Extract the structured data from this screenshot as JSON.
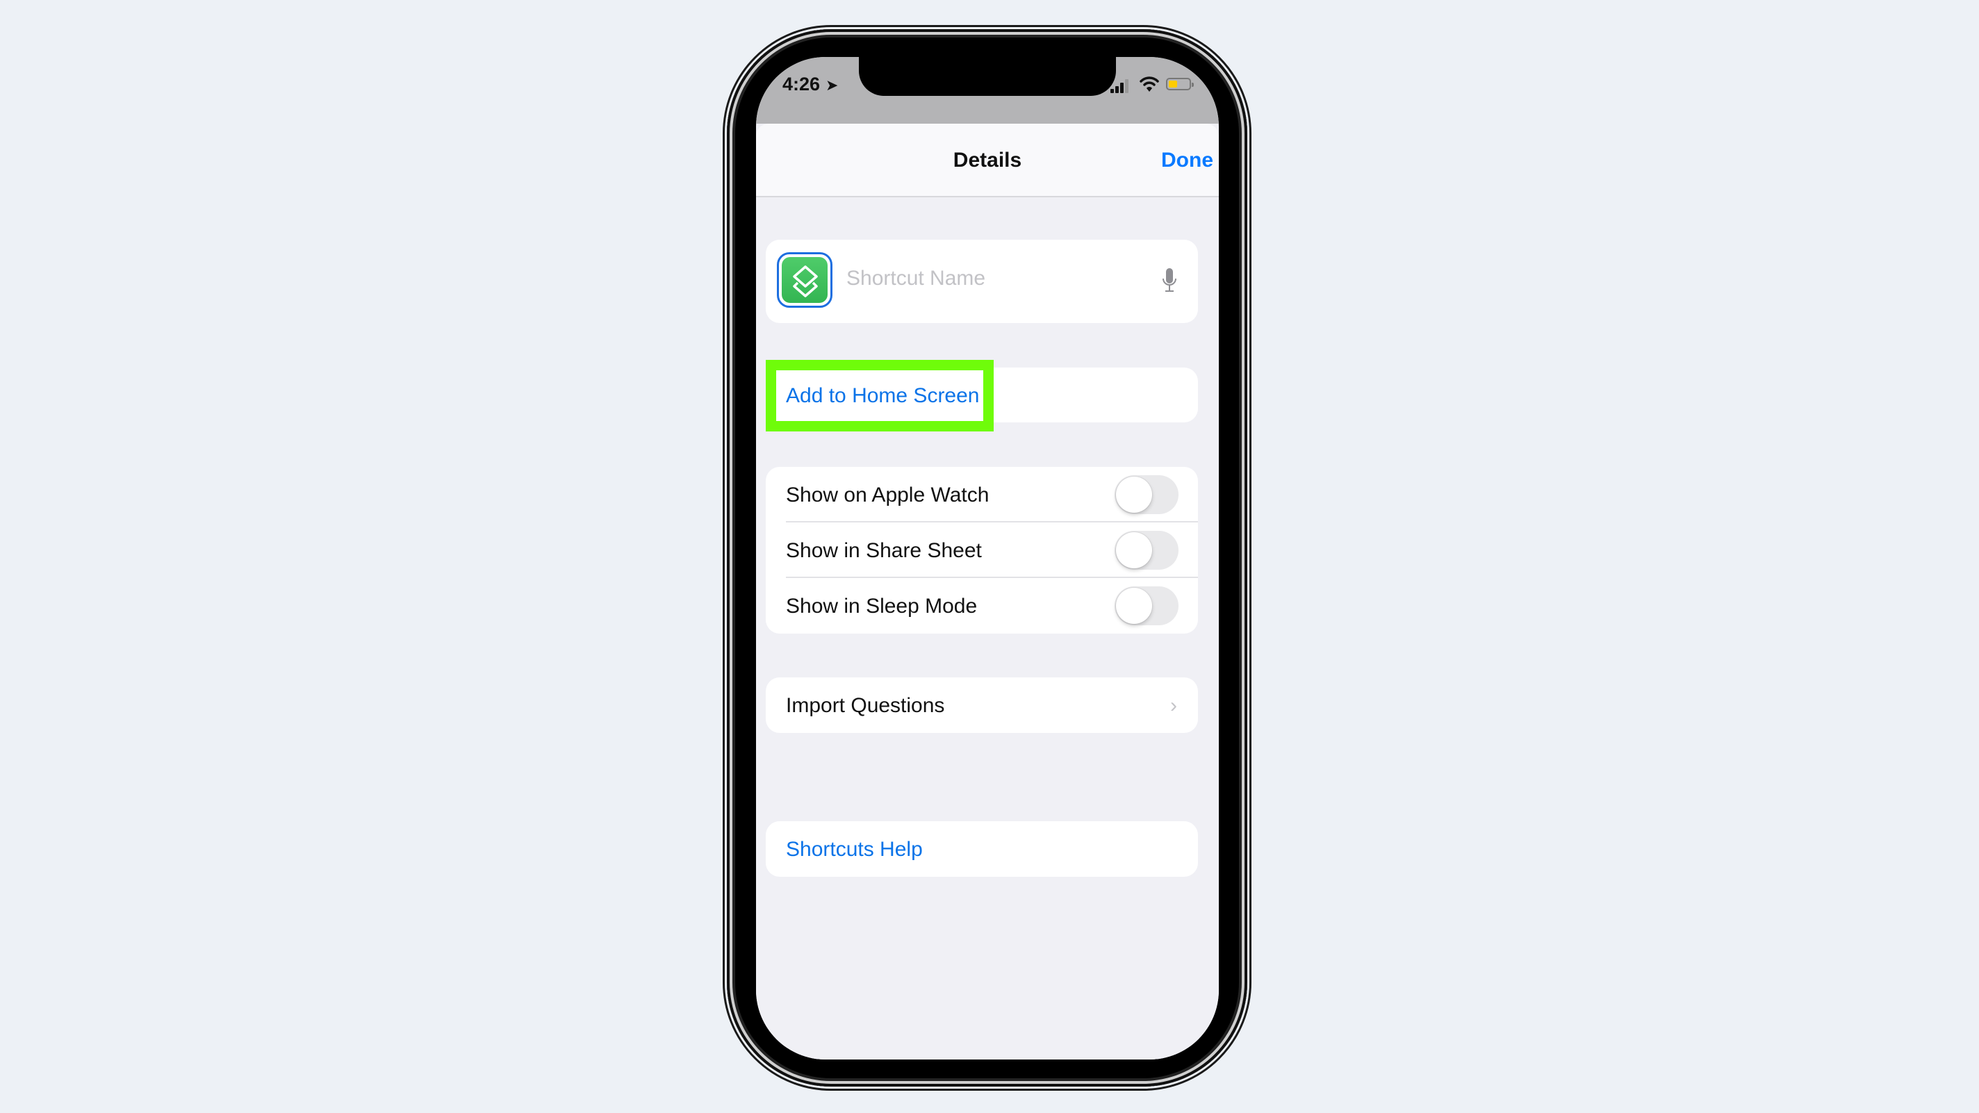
{
  "status_bar": {
    "time": "4:26",
    "location_icon": "location-arrow-icon",
    "signal_icon": "cellular-signal-icon",
    "wifi_icon": "wifi-icon",
    "battery_icon": "battery-low-icon",
    "battery_color": "#ffcc00"
  },
  "nav": {
    "title": "Details",
    "done_label": "Done"
  },
  "shortcut": {
    "icon": "shortcuts-layers-icon",
    "name_value": "",
    "name_placeholder": "Shortcut Name",
    "mic_icon": "microphone-icon"
  },
  "add_to_home": {
    "label": "Add to Home Screen",
    "highlight_color": "#6ffc0a"
  },
  "toggles": [
    {
      "label": "Show on Apple Watch",
      "on": false
    },
    {
      "label": "Show in Share Sheet",
      "on": false
    },
    {
      "label": "Show in Sleep Mode",
      "on": false
    }
  ],
  "import": {
    "label": "Import Questions",
    "chevron": "›"
  },
  "help": {
    "label": "Shortcuts Help"
  },
  "colors": {
    "accent": "#0a7aff",
    "background": "#f0f0f5"
  }
}
